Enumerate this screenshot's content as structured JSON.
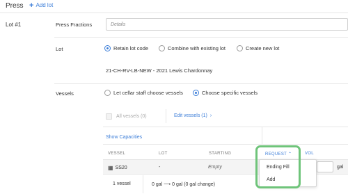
{
  "section": {
    "title": "Press",
    "add_lot": "Add lot"
  },
  "lot": {
    "label": "Lot #1",
    "press_fractions": {
      "label": "Press Fractions",
      "placeholder": "Details"
    },
    "lot_field": {
      "label": "Lot",
      "options": [
        "Retain lot code",
        "Combine with existing lot",
        "Create new lot"
      ],
      "selected": "Retain lot code",
      "code": "21-CH-RV-LB-NEW - 2021 Lewis Chardonnay"
    },
    "vessels": {
      "label": "Vessels",
      "options": [
        "Let cellar staff choose vessels",
        "Choose specific vessels"
      ],
      "selected": "Choose specific vessels",
      "all_vessels": "All vessels (0)",
      "edit_vessels": "Edit vessels (1)",
      "edit_chevron": "›",
      "show_capacities": "Show Capacities"
    }
  },
  "table": {
    "headers": {
      "vessel": "VESSEL",
      "lot": "LOT",
      "starting": "STARTING",
      "request": "REQUEST",
      "request_caret": "⌃",
      "vol": "VOL"
    },
    "row": {
      "vessel": "SS20",
      "lot": "-",
      "starting": "Empty",
      "unit": "gal"
    },
    "summary": {
      "count": "1 vessel",
      "change": "0 gal ⟶ 0 gal (0 gal change)"
    }
  },
  "request_menu": {
    "items": [
      "Ending Fill",
      "Add"
    ]
  },
  "colors": {
    "accent": "#3b7dd8",
    "highlight": "#6fc47a"
  }
}
